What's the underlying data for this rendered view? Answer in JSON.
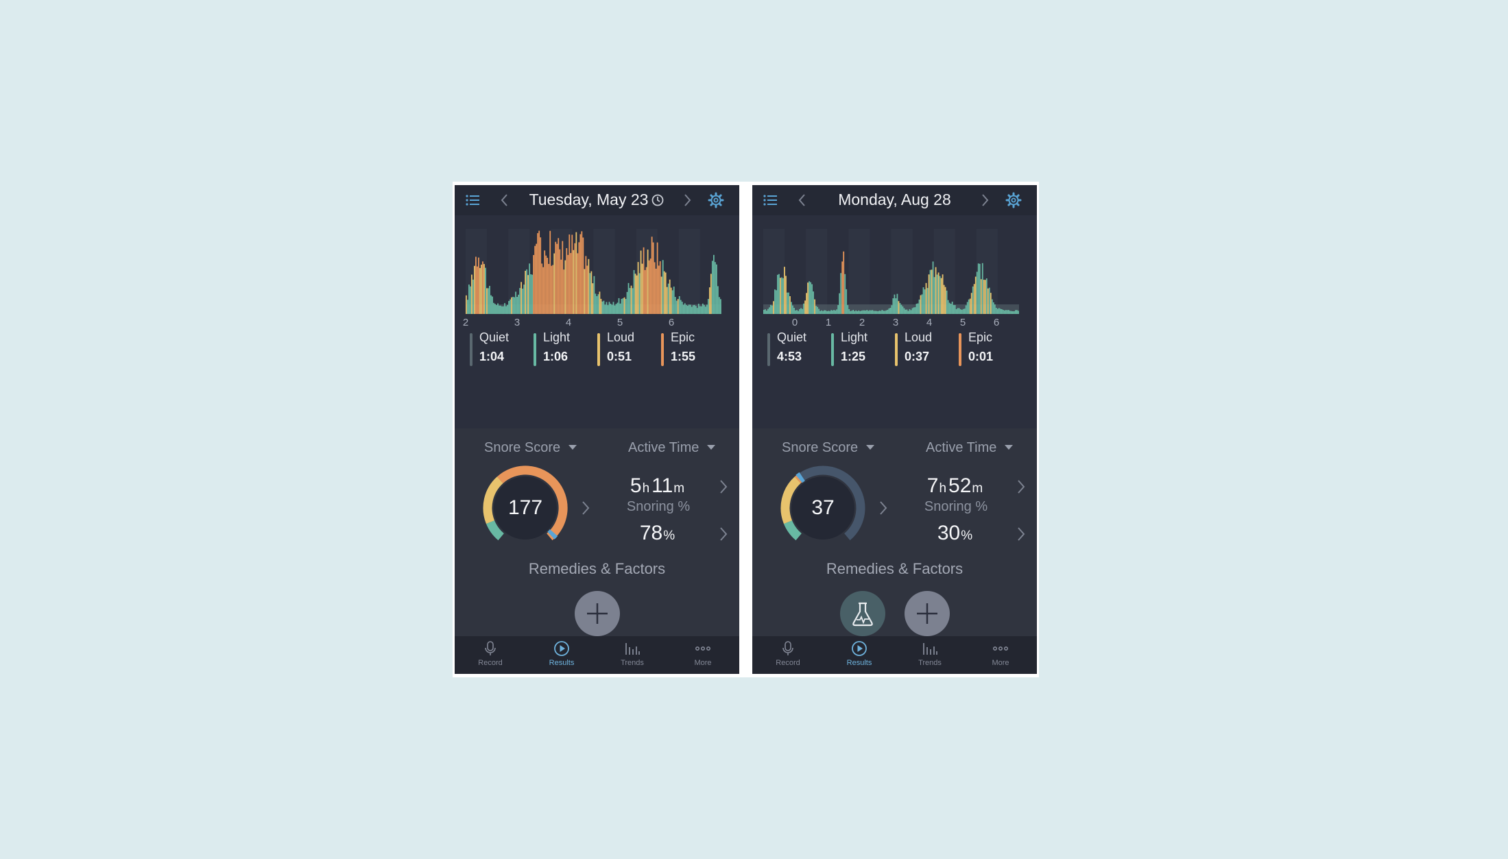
{
  "colors": {
    "quiet": "#5a6870",
    "light": "#68b9a3",
    "loud": "#e8c36d",
    "epic": "#e8955a",
    "accent": "#5aa5d6",
    "background": "#dcebee"
  },
  "phones": [
    {
      "header": {
        "title": "Tuesday, May 23",
        "menu_icon": "list-icon",
        "prev_icon": "chevron-left-icon",
        "clock_icon": "clock-icon",
        "next_icon": "chevron-right-icon",
        "settings_icon": "gear-icon"
      },
      "chart_data": {
        "type": "bar",
        "x_ticks": [
          "2",
          "3",
          "4",
          "5",
          "6"
        ],
        "series": [
          {
            "name": "Quiet"
          },
          {
            "name": "Light"
          },
          {
            "name": "Loud"
          },
          {
            "name": "Epic"
          }
        ],
        "grid": true
      },
      "legend": [
        {
          "label": "Quiet",
          "value": "1:04",
          "color": "#5a6870"
        },
        {
          "label": "Light",
          "value": "1:06",
          "color": "#68b9a3"
        },
        {
          "label": "Loud",
          "value": "0:51",
          "color": "#e8c36d"
        },
        {
          "label": "Epic",
          "value": "1:55",
          "color": "#e8955a"
        }
      ],
      "snore_score": {
        "label": "Snore Score",
        "value": "177",
        "level": 1.0
      },
      "active_time": {
        "label": "Active Time",
        "hours": "5",
        "h_unit": "h",
        "minutes": "11",
        "m_unit": "m"
      },
      "snoring": {
        "label": "Snoring %",
        "value": "78",
        "unit": "%"
      },
      "remedies_title": "Remedies & Factors",
      "tabs": [
        {
          "label": "Record",
          "icon": "microphone-icon"
        },
        {
          "label": "Results",
          "icon": "play-icon",
          "active": true
        },
        {
          "label": "Trends",
          "icon": "bar-chart-icon"
        },
        {
          "label": "More",
          "icon": "more-icon"
        }
      ]
    },
    {
      "header": {
        "title": "Monday, Aug 28",
        "menu_icon": "list-icon",
        "prev_icon": "chevron-left-icon",
        "next_icon": "chevron-right-icon",
        "settings_icon": "gear-icon"
      },
      "chart_data": {
        "type": "bar",
        "x_ticks": [
          "0",
          "1",
          "2",
          "3",
          "4",
          "5",
          "6"
        ],
        "series": [
          {
            "name": "Quiet"
          },
          {
            "name": "Light"
          },
          {
            "name": "Loud"
          },
          {
            "name": "Epic"
          }
        ],
        "grid": true
      },
      "legend": [
        {
          "label": "Quiet",
          "value": "4:53",
          "color": "#5a6870"
        },
        {
          "label": "Light",
          "value": "1:25",
          "color": "#68b9a3"
        },
        {
          "label": "Loud",
          "value": "0:37",
          "color": "#e8c36d"
        },
        {
          "label": "Epic",
          "value": "0:01",
          "color": "#e8955a"
        }
      ],
      "snore_score": {
        "label": "Snore Score",
        "value": "37",
        "level": 0.37
      },
      "active_time": {
        "label": "Active Time",
        "hours": "7",
        "h_unit": "h",
        "minutes": "52",
        "m_unit": "m"
      },
      "snoring": {
        "label": "Snoring %",
        "value": "30",
        "unit": "%"
      },
      "remedies_title": "Remedies & Factors",
      "tabs": [
        {
          "label": "Record",
          "icon": "microphone-icon"
        },
        {
          "label": "Results",
          "icon": "play-icon",
          "active": true
        },
        {
          "label": "Trends",
          "icon": "bar-chart-icon"
        },
        {
          "label": "More",
          "icon": "more-icon"
        }
      ]
    }
  ]
}
